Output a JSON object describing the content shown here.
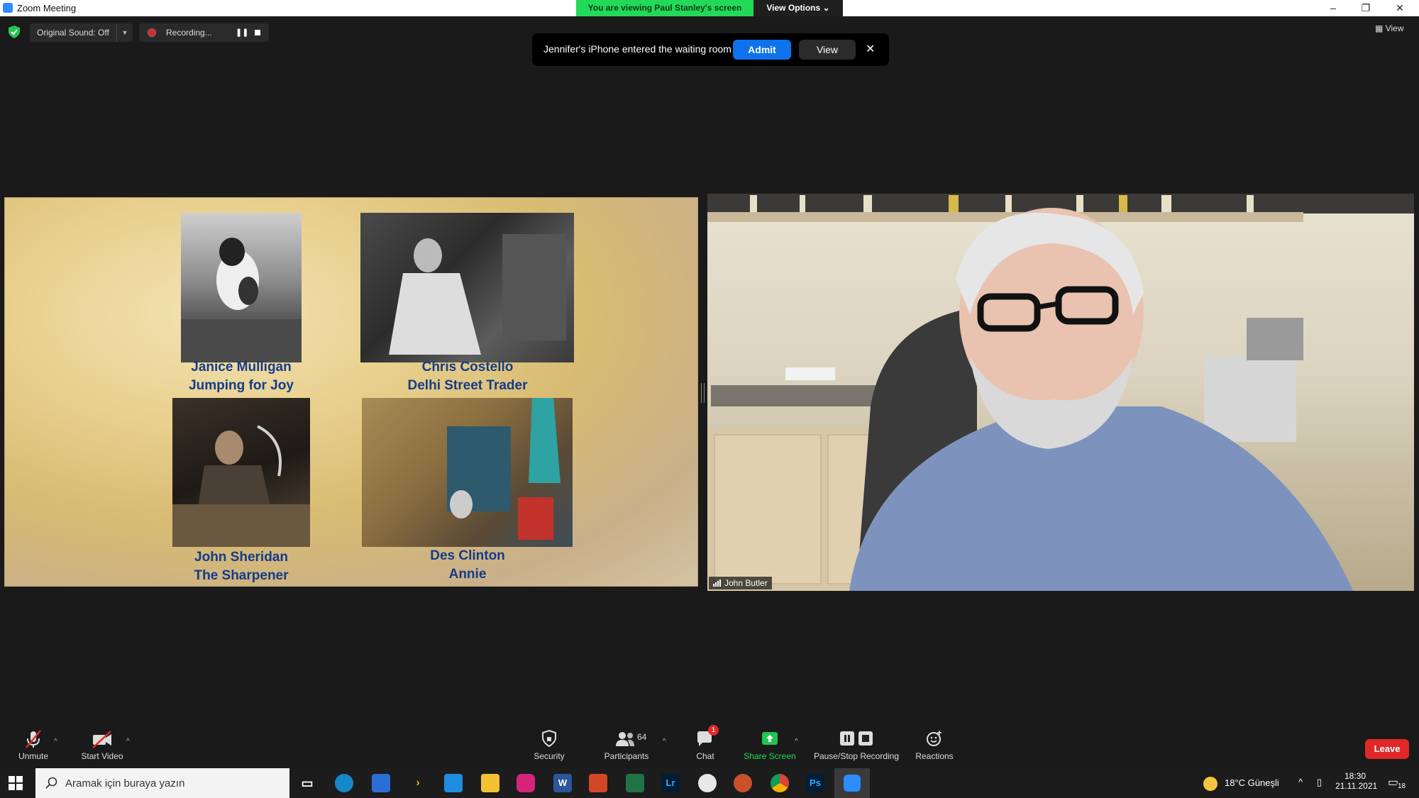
{
  "window": {
    "title": "Zoom Meeting",
    "banner": "You are viewing Paul Stanley's screen",
    "view_options": "View Options",
    "minimize": "–",
    "restore": "❐",
    "close": "✕"
  },
  "top_bar": {
    "original_sound": "Original Sound: Off",
    "recording": "Recording...",
    "pause": "❚❚",
    "view": "View"
  },
  "waiting_room": {
    "message": "Jennifer's iPhone entered the waiting room",
    "admit": "Admit",
    "view": "View",
    "close": "✕"
  },
  "shared_screen": {
    "entries": [
      {
        "name": "Janice Mulligan",
        "title": "Jumping for Joy"
      },
      {
        "name": "Chris Costello",
        "title": "Delhi Street Trader"
      },
      {
        "name": "John Sheridan",
        "title": "The Sharpener"
      },
      {
        "name": "Des Clinton",
        "title": "Annie"
      }
    ]
  },
  "video": {
    "participant_name": "John Butler"
  },
  "toolbar": {
    "unmute": "Unmute",
    "start_video": "Start Video",
    "security": "Security",
    "participants": "Participants",
    "participants_count": "64",
    "chat": "Chat",
    "chat_badge": "1",
    "share_screen": "Share Screen",
    "pause_stop_recording": "Pause/Stop Recording",
    "reactions": "Reactions",
    "leave": "Leave",
    "caret": "^"
  },
  "taskbar": {
    "search_placeholder": "Aramak için buraya yazın",
    "apps": [
      "W",
      "Lr",
      "Ps"
    ],
    "weather": "18°C  Güneşli",
    "time": "18:30",
    "date": "21.11.2021",
    "notifications": "18"
  },
  "colors": {
    "accent": "#0e72ed",
    "banner_green": "#23d959",
    "leave_red": "#e02828",
    "caption_blue": "#143b8a"
  }
}
